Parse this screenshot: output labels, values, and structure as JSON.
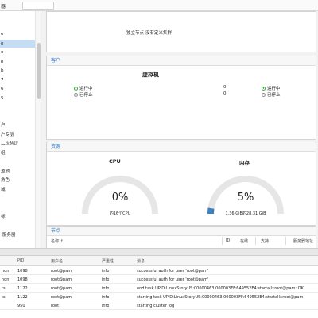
{
  "topbar": {
    "title": "器"
  },
  "sidebar": {
    "items": [
      {
        "label": "e",
        "selected": false
      },
      {
        "label": "e",
        "selected": true
      },
      {
        "label": "e",
        "selected": false
      },
      {
        "label": "h",
        "selected": false
      },
      {
        "label": "b",
        "selected": false
      },
      {
        "label": "7",
        "selected": false
      },
      {
        "label": "6",
        "selected": false
      },
      {
        "label": "5",
        "selected": false
      },
      {
        "label": "",
        "selected": false
      },
      {
        "label": "",
        "selected": false
      },
      {
        "label": "户",
        "selected": false
      },
      {
        "label": "户专册",
        "selected": false
      },
      {
        "label": "二次验证",
        "selected": false
      },
      {
        "label": "组",
        "selected": false
      },
      {
        "label": "",
        "selected": false
      },
      {
        "label": "源池",
        "selected": false
      },
      {
        "label": "角色",
        "selected": false
      },
      {
        "label": "域",
        "selected": false
      },
      {
        "label": "",
        "selected": false
      },
      {
        "label": "",
        "selected": false
      },
      {
        "label": "标",
        "selected": false
      },
      {
        "label": "",
        "selected": false
      },
      {
        "label": "-服务器",
        "selected": false
      }
    ]
  },
  "cluster": {
    "text": "独立节点-没有定义集群"
  },
  "guests": {
    "header": "客户",
    "vm_title": "虚拟机",
    "running_label": "运行中",
    "stopped_label": "已停止",
    "vm_running": "0",
    "vm_stopped": "0",
    "ct_running_label": "运行中",
    "ct_stopped_label": "已停止"
  },
  "resources": {
    "header": "资源",
    "cpu": {
      "title": "CPU",
      "value": "0%",
      "sub": "的16个CPU",
      "fraction": 0.0
    },
    "memory": {
      "title": "内存",
      "value": "5%",
      "sub": "1.36 GiB的28.31 GiB",
      "fraction": 0.05
    }
  },
  "nodes": {
    "header": "节点",
    "columns": [
      "名称 ↑",
      "ID",
      "在线",
      "支持",
      "服务器地址"
    ]
  },
  "log": {
    "columns": [
      "",
      "PID",
      "用户名",
      "严重性",
      "消息"
    ],
    "rows": [
      {
        "node": "non",
        "pid": "1098",
        "user": "root@pam",
        "severity": "info",
        "message": "successful auth for user 'root@pam'"
      },
      {
        "node": "non",
        "pid": "1098",
        "user": "root@pam",
        "severity": "info",
        "message": "successful auth for user 'root@pam'"
      },
      {
        "node": "ts",
        "pid": "1122",
        "user": "root@pam",
        "severity": "info",
        "message": "end task UPID:LinuxStoryUS:00000463:000003FF:649552E4:startall::root@pam: OK"
      },
      {
        "node": "ts",
        "pid": "1122",
        "user": "root@pam",
        "severity": "info",
        "message": "starting task UPID:LinuxStoryUS:00000463:000003FF:649552E4:startall::root@pam:"
      },
      {
        "node": "",
        "pid": "950",
        "user": "root",
        "severity": "info",
        "message": "starting cluster log"
      }
    ]
  },
  "colors": {
    "accent": "#2e7bcf",
    "running": "#3da33d",
    "gauge_track": "#e6e6e6",
    "gauge_fill": "#3b82c4"
  }
}
